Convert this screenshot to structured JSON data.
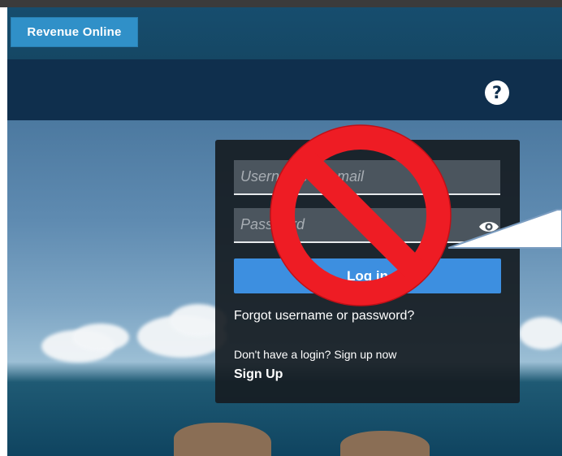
{
  "header": {
    "app_button_label": "Revenue Online"
  },
  "nav": {
    "help_symbol": "?",
    "help_icon": "question-circle-icon"
  },
  "login": {
    "username_placeholder": "Username or email",
    "password_placeholder": "Password",
    "password_visibility_icon": "eye-icon",
    "login_button_label": "Log in",
    "forgot_link": "Forgot username or password?",
    "signup_prompt": "Don't have a login? Sign up now",
    "signup_link": "Sign Up"
  },
  "annotation": {
    "prohibited_icon": "no-symbol-icon",
    "color": "#ee1c24",
    "callout": "speech-callout-shape"
  },
  "colors": {
    "app_bar": "#164d6e",
    "brand_button": "#3090c8",
    "nav_bar": "#0f2f4d",
    "login_button": "#3d8fe0"
  }
}
